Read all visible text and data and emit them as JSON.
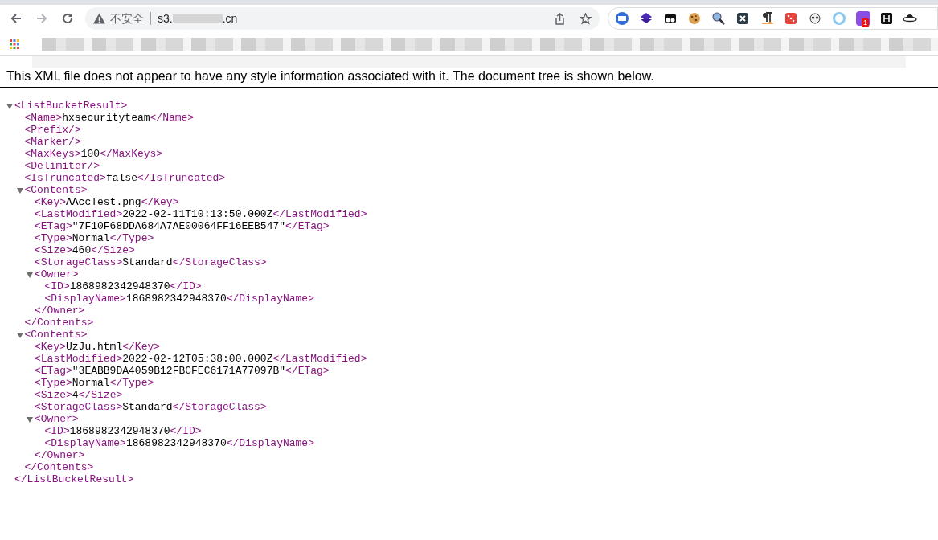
{
  "address_bar": {
    "security_label": "不安全",
    "url_start": "s3.",
    "url_end": ".cn"
  },
  "extension_badge": "1",
  "notice": "This XML file does not appear to have any style information associated with it. The document tree is shown below.",
  "xml": {
    "kind": "element",
    "open_tag": "<ListBucketResult>",
    "close_tag": "</ListBucketResult>",
    "expanded": true,
    "children": [
      {
        "kind": "leaf",
        "open_tag": "<Name>",
        "value": "hxsecurityteam",
        "close_tag": "</Name>"
      },
      {
        "kind": "empty",
        "tag": "<Prefix/>"
      },
      {
        "kind": "empty",
        "tag": "<Marker/>"
      },
      {
        "kind": "leaf",
        "open_tag": "<MaxKeys>",
        "value": "100",
        "close_tag": "</MaxKeys>"
      },
      {
        "kind": "empty",
        "tag": "<Delimiter/>"
      },
      {
        "kind": "leaf",
        "open_tag": "<IsTruncated>",
        "value": "false",
        "close_tag": "</IsTruncated>"
      },
      {
        "kind": "element",
        "open_tag": "<Contents>",
        "close_tag": "</Contents>",
        "expanded": true,
        "children": [
          {
            "kind": "leaf",
            "open_tag": "<Key>",
            "value": "AAccTest.png",
            "close_tag": "</Key>"
          },
          {
            "kind": "leaf",
            "open_tag": "<LastModified>",
            "value": "2022-02-11T10:13:50.000Z",
            "close_tag": "</LastModified>"
          },
          {
            "kind": "leaf",
            "open_tag": "<ETag>",
            "value": "\"7F10F68DDA684A7AE00064FF16EEB547\"",
            "close_tag": "</ETag>"
          },
          {
            "kind": "leaf",
            "open_tag": "<Type>",
            "value": "Normal",
            "close_tag": "</Type>"
          },
          {
            "kind": "leaf",
            "open_tag": "<Size>",
            "value": "460",
            "close_tag": "</Size>"
          },
          {
            "kind": "leaf",
            "open_tag": "<StorageClass>",
            "value": "Standard",
            "close_tag": "</StorageClass>"
          },
          {
            "kind": "element",
            "open_tag": "<Owner>",
            "close_tag": "</Owner>",
            "expanded": true,
            "children": [
              {
                "kind": "leaf",
                "open_tag": "<ID>",
                "value": "1868982342948370",
                "close_tag": "</ID>"
              },
              {
                "kind": "leaf",
                "open_tag": "<DisplayName>",
                "value": "1868982342948370",
                "close_tag": "</DisplayName>"
              }
            ]
          }
        ]
      },
      {
        "kind": "element",
        "open_tag": "<Contents>",
        "close_tag": "</Contents>",
        "expanded": true,
        "children": [
          {
            "kind": "leaf",
            "open_tag": "<Key>",
            "value": "UzJu.html",
            "close_tag": "</Key>"
          },
          {
            "kind": "leaf",
            "open_tag": "<LastModified>",
            "value": "2022-02-12T05:38:00.000Z",
            "close_tag": "</LastModified>"
          },
          {
            "kind": "leaf",
            "open_tag": "<ETag>",
            "value": "\"3EABB9DA4059B12FBCFEC6171A77097B\"",
            "close_tag": "</ETag>"
          },
          {
            "kind": "leaf",
            "open_tag": "<Type>",
            "value": "Normal",
            "close_tag": "</Type>"
          },
          {
            "kind": "leaf",
            "open_tag": "<Size>",
            "value": "4",
            "close_tag": "</Size>"
          },
          {
            "kind": "leaf",
            "open_tag": "<StorageClass>",
            "value": "Standard",
            "close_tag": "</StorageClass>"
          },
          {
            "kind": "element",
            "open_tag": "<Owner>",
            "close_tag": "</Owner>",
            "expanded": true,
            "children": [
              {
                "kind": "leaf",
                "open_tag": "<ID>",
                "value": "1868982342948370",
                "close_tag": "</ID>"
              },
              {
                "kind": "leaf",
                "open_tag": "<DisplayName>",
                "value": "1868982342948370",
                "close_tag": "</DisplayName>"
              }
            ]
          }
        ]
      }
    ]
  }
}
